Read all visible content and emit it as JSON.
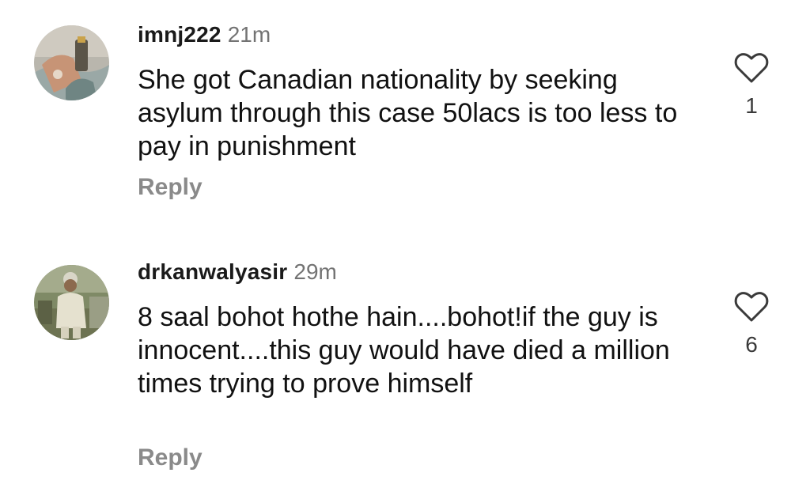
{
  "comments": [
    {
      "username": "imnj222",
      "time": "21m",
      "text": "She got Canadian nationality by seeking asylum through this case 50lacs is too less to pay in punishment",
      "reply_label": "Reply",
      "like_icon": "heart-outline-icon",
      "like_count": "1"
    },
    {
      "username": "drkanwalyasir",
      "time": "29m",
      "text": "8 saal bohot hothe hain....bohot!if the guy is innocent....this guy would have died a million times trying to prove himself",
      "reply_label": "Reply",
      "like_icon": "heart-outline-icon",
      "like_count": "6"
    }
  ]
}
